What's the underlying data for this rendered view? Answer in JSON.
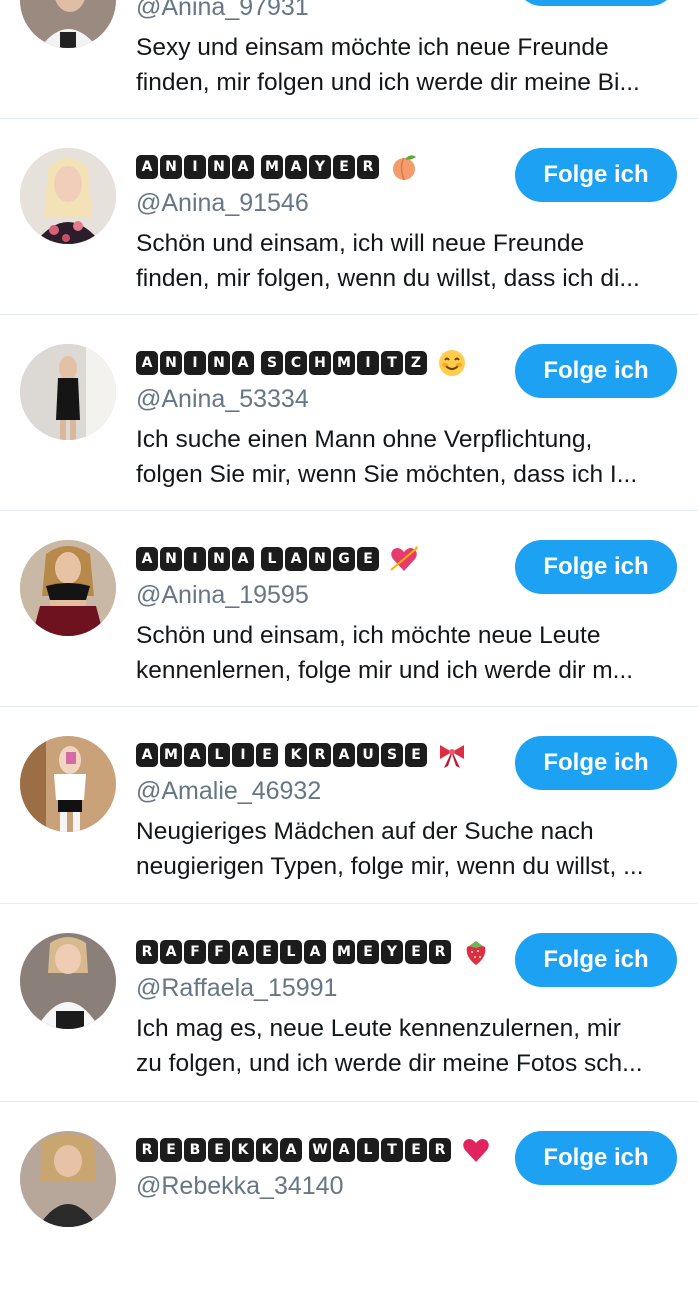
{
  "top_partial": {
    "handle": "@Anina_97931",
    "bio_line1": "Sexy und einsam möchte ich neue Freunde",
    "bio_line2": "finden, mir folgen und ich werde dir meine Bi..."
  },
  "follow_label": "Folge ich",
  "users": [
    {
      "name_tiles": "ANINA MAYER",
      "name": "ANINA MAYER",
      "emoji": "peach-emoji",
      "handle": "@Anina_91546",
      "bio_line1": "Schön und einsam, ich will neue Freunde",
      "bio_line2": "finden, mir folgen, wenn du willst, dass ich di..."
    },
    {
      "name_tiles": "ANINA SCHMITZ",
      "name": "ANINA SCHMITZ",
      "emoji": "smiling-face-emoji",
      "handle": "@Anina_53334",
      "bio_line1": "Ich suche einen Mann ohne Verpflichtung,",
      "bio_line2": "folgen Sie mir, wenn Sie möchten, dass ich I..."
    },
    {
      "name_tiles": "ANINA LANGE",
      "name": "ANINA LANGE",
      "emoji": "heart-with-arrow-emoji",
      "handle": "@Anina_19595",
      "bio_line1": "Schön und einsam, ich möchte neue Leute",
      "bio_line2": "kennenlernen, folge mir und ich werde dir m..."
    },
    {
      "name_tiles": "AMALIE KRAUSE",
      "name": "AMALIE KRAUSE",
      "emoji": "ribbon-emoji",
      "handle": "@Amalie_46932",
      "bio_line1": "Neugieriges Mädchen auf der Suche nach",
      "bio_line2": "neugierigen Typen, folge mir, wenn du willst, ..."
    },
    {
      "name_tiles": "RAFFAELA MEYER",
      "name": "RAFFAELA MEYER",
      "emoji": "strawberry-emoji",
      "handle": "@Raffaela_15991",
      "bio_line1": "Ich mag es, neue Leute kennenzulernen, mir",
      "bio_line2": "zu folgen, und ich werde dir meine Fotos sch..."
    },
    {
      "name_tiles": "REBEKKA WALTER",
      "name": "REBEKKA WALTER",
      "emoji": "heart-emoji",
      "handle": "@Rebekka_34140",
      "bio_line1": "",
      "bio_line2": ""
    }
  ],
  "colors": {
    "accent": "#1da1f2",
    "handle_text": "#657786",
    "divider": "#e6ecf0",
    "tile_background": "#1c1c1c"
  }
}
